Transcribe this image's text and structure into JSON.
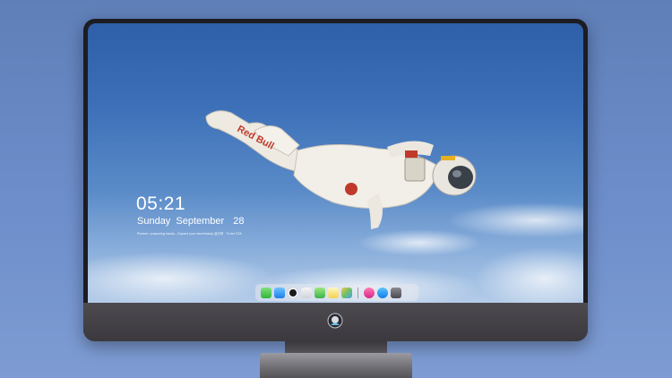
{
  "lockscreen": {
    "time": "05:21",
    "weekday": "Sunday",
    "month": "September",
    "day": "28",
    "quote": "Pioneer: consuming hands... Expand your mind beauty   运行时   · To the STA"
  },
  "wallpaper": {
    "suit_text": "Red Bull"
  },
  "dock": {
    "apps": [
      "messages-icon",
      "finder-icon",
      "safari-icon",
      "notes-icon",
      "video-icon",
      "notepad-icon",
      "photos-icon",
      "music-icon",
      "appstore-icon",
      "camera-icon"
    ]
  },
  "colors": {
    "sky_top": "#2e5fa8",
    "sky_bottom": "#b4cce8",
    "bezel": "#1c1c22",
    "chin": "#4d4a50"
  }
}
